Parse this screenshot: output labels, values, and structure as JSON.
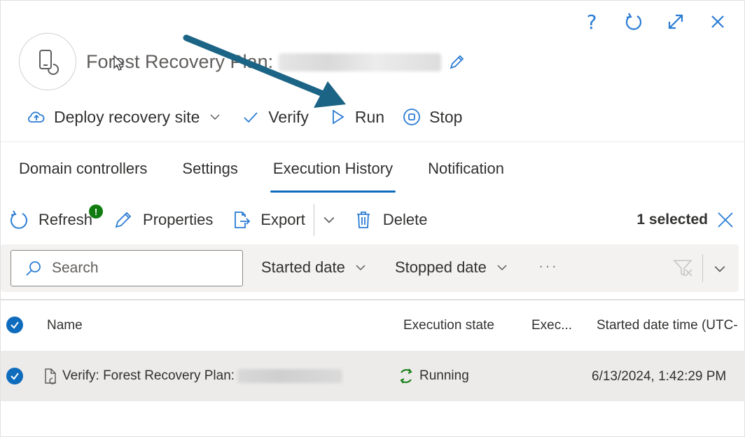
{
  "window_controls": {
    "help_glyph": "?",
    "icons": [
      "help-icon",
      "refresh-icon",
      "expand-icon",
      "close-icon"
    ]
  },
  "header": {
    "avatar_icon": "phone-restore-icon",
    "title": "Forest Recovery Plan:",
    "edit_icon": "pencil-icon"
  },
  "commands": {
    "deploy": "Deploy recovery site",
    "verify": "Verify",
    "run": "Run",
    "stop": "Stop"
  },
  "tabs": [
    {
      "label": "Domain controllers",
      "active": false
    },
    {
      "label": "Settings",
      "active": false
    },
    {
      "label": "Execution History",
      "active": true
    },
    {
      "label": "Notification",
      "active": false
    }
  ],
  "toolbar": {
    "refresh": "Refresh",
    "badge": "!",
    "properties": "Properties",
    "export": "Export",
    "delete": "Delete",
    "selected_count": "1 selected"
  },
  "filters": {
    "search_placeholder": "Search",
    "started_date": "Started date",
    "stopped_date": "Stopped date",
    "more": "···"
  },
  "table": {
    "columns": {
      "name": "Name",
      "execution_state": "Execution state",
      "exec": "Exec...",
      "started": "Started date time (UTC-"
    },
    "rows": [
      {
        "name": "Verify: Forest Recovery Plan:",
        "state": "Running",
        "started": "6/13/2024, 1:42:29 PM",
        "selected": true
      }
    ]
  },
  "colors": {
    "accent": "#0f6cbd",
    "icon_blue": "#2b7cd3",
    "arrow": "#1b6485",
    "running_green": "#107c10",
    "selected_row": "#edebe9"
  }
}
